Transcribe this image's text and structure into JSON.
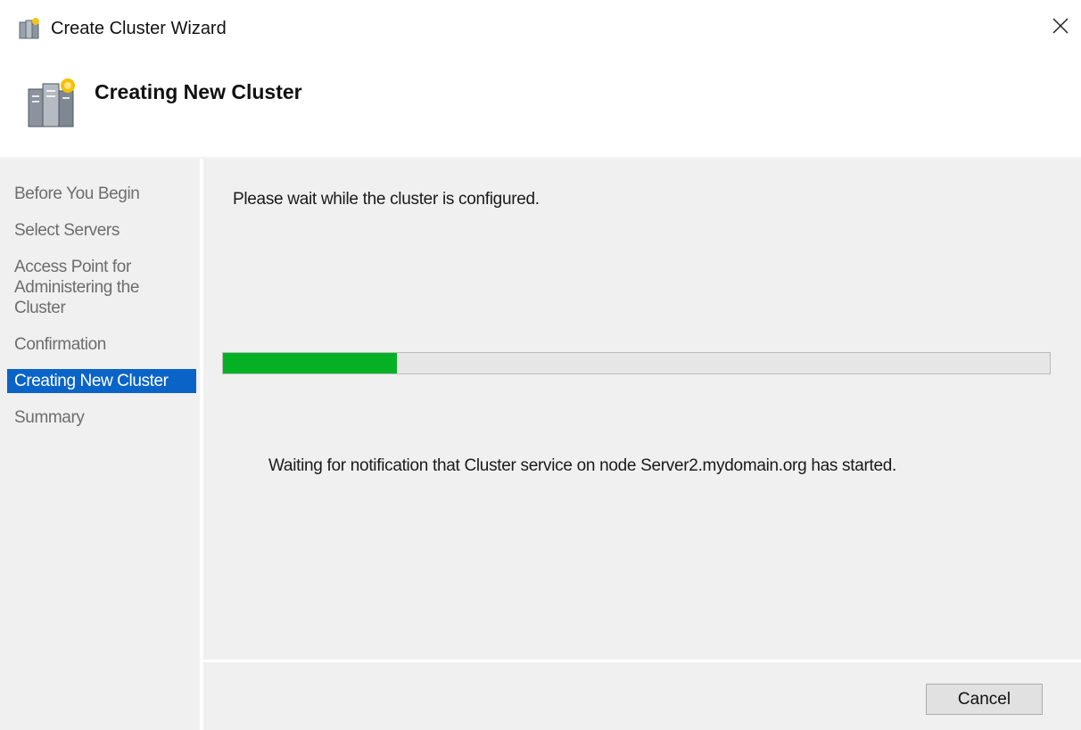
{
  "window": {
    "title": "Create Cluster Wizard",
    "title_icon": "cluster-wizard-icon",
    "close_icon": "close-icon"
  },
  "header": {
    "title": "Creating New Cluster",
    "icon": "cluster-servers-icon"
  },
  "sidebar": {
    "steps": [
      {
        "label": "Before You Begin",
        "active": false
      },
      {
        "label": "Select Servers",
        "active": false
      },
      {
        "label": "Access Point for Administering the Cluster",
        "active": false
      },
      {
        "label": "Confirmation",
        "active": false
      },
      {
        "label": "Creating New Cluster",
        "active": true
      },
      {
        "label": "Summary",
        "active": false
      }
    ]
  },
  "main": {
    "message": "Please wait while the cluster is configured.",
    "progress": 0.21,
    "status": "Waiting for notification that Cluster service on node Server2.mydomain.org has started."
  },
  "footer": {
    "cancel_label": "Cancel"
  },
  "colors": {
    "accent": "#0a64c8",
    "progress_fill": "#06b025",
    "panel_bg": "#f0f0f0"
  }
}
